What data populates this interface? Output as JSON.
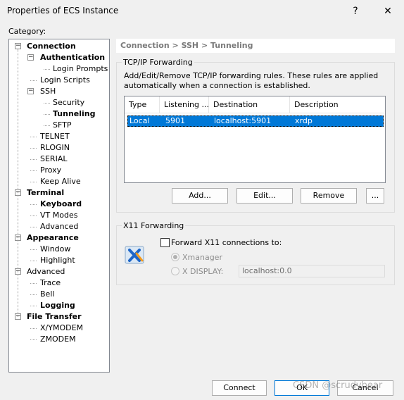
{
  "window": {
    "title": "Properties of ECS Instance",
    "help": "?",
    "close": "✕"
  },
  "category_label": "Category:",
  "tree": [
    {
      "label": "Connection",
      "bold": true,
      "level": 0,
      "exp": "-"
    },
    {
      "label": "Authentication",
      "bold": true,
      "level": 1,
      "exp": "-"
    },
    {
      "label": "Login Prompts",
      "bold": false,
      "level": 2
    },
    {
      "label": "Login Scripts",
      "bold": false,
      "level": 1
    },
    {
      "label": "SSH",
      "bold": false,
      "level": 1,
      "exp": "-"
    },
    {
      "label": "Security",
      "bold": false,
      "level": 2
    },
    {
      "label": "Tunneling",
      "bold": true,
      "level": 2
    },
    {
      "label": "SFTP",
      "bold": false,
      "level": 2
    },
    {
      "label": "TELNET",
      "bold": false,
      "level": 1
    },
    {
      "label": "RLOGIN",
      "bold": false,
      "level": 1
    },
    {
      "label": "SERIAL",
      "bold": false,
      "level": 1
    },
    {
      "label": "Proxy",
      "bold": false,
      "level": 1
    },
    {
      "label": "Keep Alive",
      "bold": false,
      "level": 1
    },
    {
      "label": "Terminal",
      "bold": true,
      "level": 0,
      "exp": "-"
    },
    {
      "label": "Keyboard",
      "bold": true,
      "level": 1
    },
    {
      "label": "VT Modes",
      "bold": false,
      "level": 1
    },
    {
      "label": "Advanced",
      "bold": false,
      "level": 1
    },
    {
      "label": "Appearance",
      "bold": true,
      "level": 0,
      "exp": "-"
    },
    {
      "label": "Window",
      "bold": false,
      "level": 1
    },
    {
      "label": "Highlight",
      "bold": false,
      "level": 1
    },
    {
      "label": "Advanced",
      "bold": false,
      "level": 0,
      "exp": "-"
    },
    {
      "label": "Trace",
      "bold": false,
      "level": 1
    },
    {
      "label": "Bell",
      "bold": false,
      "level": 1
    },
    {
      "label": "Logging",
      "bold": true,
      "level": 1
    },
    {
      "label": "File Transfer",
      "bold": true,
      "level": 0,
      "exp": "-"
    },
    {
      "label": "X/YMODEM",
      "bold": false,
      "level": 1
    },
    {
      "label": "ZMODEM",
      "bold": false,
      "level": 1
    }
  ],
  "breadcrumb": "Connection > SSH > Tunneling",
  "tcpip": {
    "group_title": "TCP/IP Forwarding",
    "desc_line1": "Add/Edit/Remove TCP/IP forwarding rules. These rules are applied",
    "desc_line2": "automatically when a connection is established.",
    "columns": [
      "Type",
      "Listening ...",
      "Destination",
      "Description"
    ],
    "rows": [
      {
        "type": "Local",
        "listening": "5901",
        "destination": "localhost:5901",
        "description": "xrdp"
      }
    ],
    "add": "Add...",
    "edit": "Edit...",
    "remove": "Remove",
    "more": "..."
  },
  "x11": {
    "group_title": "X11 Forwarding",
    "forward_label": "Forward X11 connections to:",
    "forward_checked": false,
    "xmanager_label": "Xmanager",
    "xmanager_checked": true,
    "xdisplay_label": "X DISPLAY:",
    "xdisplay_value": "localhost:0.0"
  },
  "footer": {
    "connect": "Connect",
    "ok": "OK",
    "cancel": "Cancel"
  },
  "watermark": "CSDN @scrudybear"
}
